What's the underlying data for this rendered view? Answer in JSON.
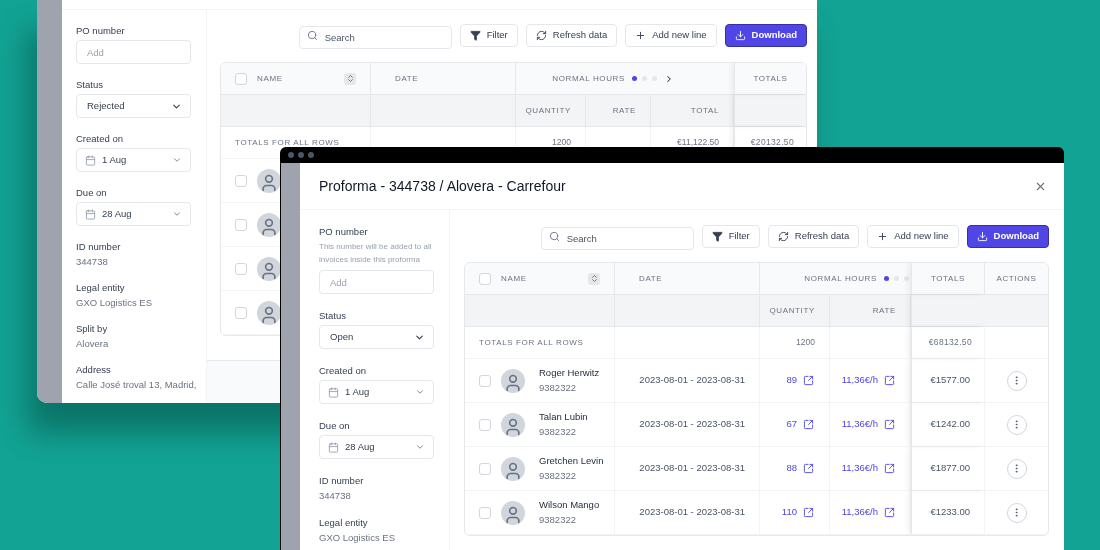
{
  "back_window": {
    "sidebar": [
      {
        "kind": "input",
        "label": "PO number",
        "placeholder": "Add"
      },
      {
        "kind": "select",
        "label": "Status",
        "value": "Rejected"
      },
      {
        "kind": "date",
        "label": "Created on",
        "value": "1 Aug"
      },
      {
        "kind": "date",
        "label": "Due on",
        "value": "28 Aug"
      },
      {
        "kind": "text",
        "label": "ID number",
        "value": "344738"
      },
      {
        "kind": "text",
        "label": "Legal entity",
        "value": "GXO Logistics ES"
      },
      {
        "kind": "text",
        "label": "Split by",
        "value": "Alovera"
      },
      {
        "kind": "text",
        "label": "Address",
        "value": "Calle José troval 13, Madrid,"
      }
    ],
    "toolbar": {
      "search_placeholder": "Search",
      "buttons": [
        {
          "kind": "filter",
          "label": "Filter"
        },
        {
          "kind": "refresh",
          "label": "Refresh data"
        },
        {
          "kind": "add",
          "label": "Add new line"
        },
        {
          "kind": "download",
          "label": "Download"
        }
      ]
    },
    "table": {
      "header_checked": false,
      "columns": {
        "name": "NAME",
        "date": "DATE",
        "group": "NORMAL HOURS",
        "totals": "TOTALS"
      },
      "next_arrow": true,
      "group_pages": [
        {
          "selected": true
        },
        {
          "selected": false
        },
        {
          "selected": false
        }
      ],
      "subcolumns": [
        "QUANTITY",
        "RATE",
        "TOTAL"
      ],
      "totals_row": {
        "label": "TOTALS FOR ALL ROWS",
        "quantity": "1200",
        "total": "€11,122.50",
        "totals": "€20132.50"
      },
      "rows": [
        {
          "checked": false
        },
        {
          "checked": false
        },
        {
          "checked": false
        },
        {
          "checked": false
        }
      ]
    }
  },
  "front_window": {
    "title": "Proforma - 344738 / Alovera - Carrefour",
    "sidebar": [
      {
        "kind": "input",
        "label": "PO number",
        "hint": "This number will be added to all invoices inside this proforma",
        "placeholder": "Add"
      },
      {
        "kind": "select",
        "label": "Status",
        "value": "Open"
      },
      {
        "kind": "date",
        "label": "Created on",
        "value": "1 Aug"
      },
      {
        "kind": "date",
        "label": "Due on",
        "value": "28 Aug"
      },
      {
        "kind": "text",
        "label": "ID number",
        "value": "344738"
      },
      {
        "kind": "text",
        "label": "Legal entity",
        "value": "GXO Logistics ES"
      }
    ],
    "toolbar": {
      "search_placeholder": "Search",
      "buttons": [
        {
          "kind": "filter",
          "label": "Filter"
        },
        {
          "kind": "refresh",
          "label": "Refresh data"
        },
        {
          "kind": "add",
          "label": "Add new line"
        },
        {
          "kind": "download",
          "label": "Download"
        }
      ]
    },
    "table": {
      "header_checked": false,
      "columns": {
        "name": "NAME",
        "date": "DATE",
        "group": "NORMAL HOURS",
        "totals": "TOTALS",
        "actions": "ACTIONS"
      },
      "group_pages": [
        {
          "selected": true
        },
        {
          "selected": false
        },
        {
          "selected": false
        }
      ],
      "subcolumns": [
        "QUANTITY",
        "RATE"
      ],
      "totals_row": {
        "label": "TOTALS FOR ALL ROWS",
        "quantity": "1200",
        "totals": "€68132.50"
      },
      "rows": [
        {
          "checked": false,
          "name": "Roger Herwitz",
          "id": "9382322",
          "date": "2023-08-01 - 2023-08-31",
          "quantity": "89",
          "rate": "11,36€/h",
          "total": "€1577.00"
        },
        {
          "checked": false,
          "name": "Talan Lubin",
          "id": "9382322",
          "date": "2023-08-01 - 2023-08-31",
          "quantity": "67",
          "rate": "11,36€/h",
          "total": "€1242.00"
        },
        {
          "checked": false,
          "name": "Gretchen Levin",
          "id": "9382322",
          "date": "2023-08-01 - 2023-08-31",
          "quantity": "88",
          "rate": "11,36€/h",
          "total": "€1877.00"
        },
        {
          "checked": false,
          "name": "Wilson Mango",
          "id": "9382322",
          "date": "2023-08-01 - 2023-08-31",
          "quantity": "110",
          "rate": "11,36€/h",
          "total": "€1233.00"
        }
      ]
    }
  }
}
